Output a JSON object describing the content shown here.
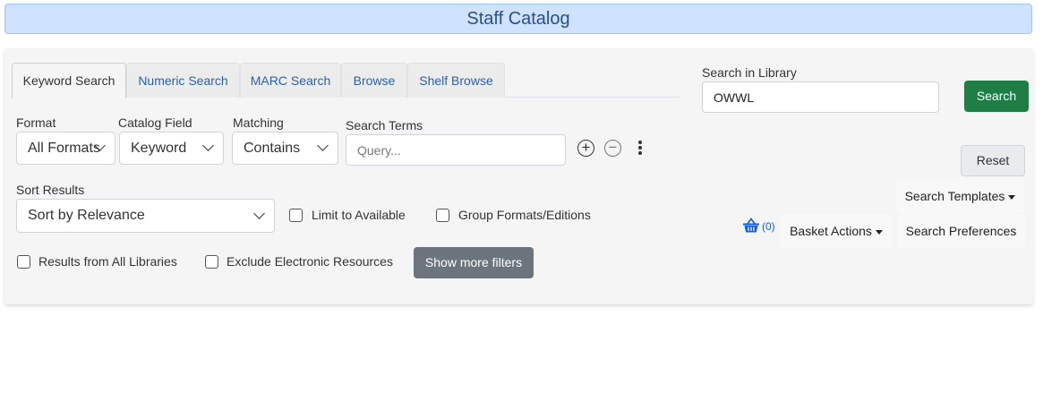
{
  "header": {
    "title": "Staff Catalog"
  },
  "tabs": [
    {
      "label": "Keyword Search"
    },
    {
      "label": "Numeric Search"
    },
    {
      "label": "MARC Search"
    },
    {
      "label": "Browse"
    },
    {
      "label": "Shelf Browse"
    }
  ],
  "search_row": {
    "format_label": "Format",
    "format_value": "All Formats",
    "field_label": "Catalog Field",
    "field_value": "Keyword",
    "matching_label": "Matching",
    "matching_value": "Contains",
    "terms_label": "Search Terms",
    "terms_placeholder": "Query...",
    "terms_value": ""
  },
  "library": {
    "label": "Search in Library",
    "value": "OWWL"
  },
  "buttons": {
    "search": "Search",
    "reset": "Reset",
    "more_filters": "Show more filters",
    "search_templates": "Search Templates",
    "basket_actions": "Basket Actions",
    "search_preferences": "Search Preferences"
  },
  "sort": {
    "label": "Sort Results",
    "value": "Sort by Relevance"
  },
  "checkboxes": {
    "limit_available": "Limit to Available",
    "group_formats": "Group Formats/Editions",
    "all_libraries": "Results from All Libraries",
    "exclude_electronic": "Exclude Electronic Resources"
  },
  "basket": {
    "count": "(0)"
  },
  "colors": {
    "accent": "#2a5fad",
    "search_button": "#1e7e46",
    "header_bg": "#cfe2ff"
  },
  "icons": {
    "add_row": "plus-circle-icon",
    "remove_row": "minus-circle-icon",
    "more": "vertical-dots-icon",
    "basket": "basket-icon"
  }
}
